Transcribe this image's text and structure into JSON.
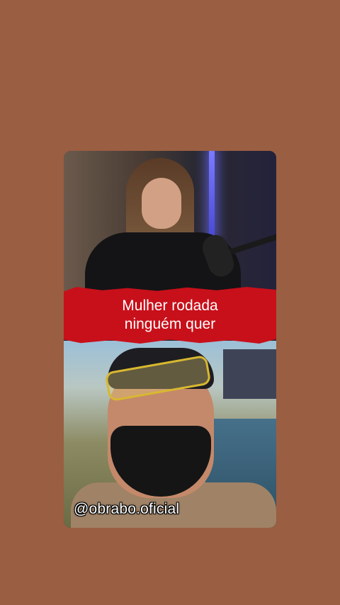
{
  "caption": {
    "line1": "Mulher rodada",
    "line2": "ninguém quer"
  },
  "watermark": {
    "handle": "@obrabo.oficial"
  },
  "colors": {
    "background": "#9a5e42",
    "banner": "#c8101a",
    "caption_text": "#ffffff"
  }
}
